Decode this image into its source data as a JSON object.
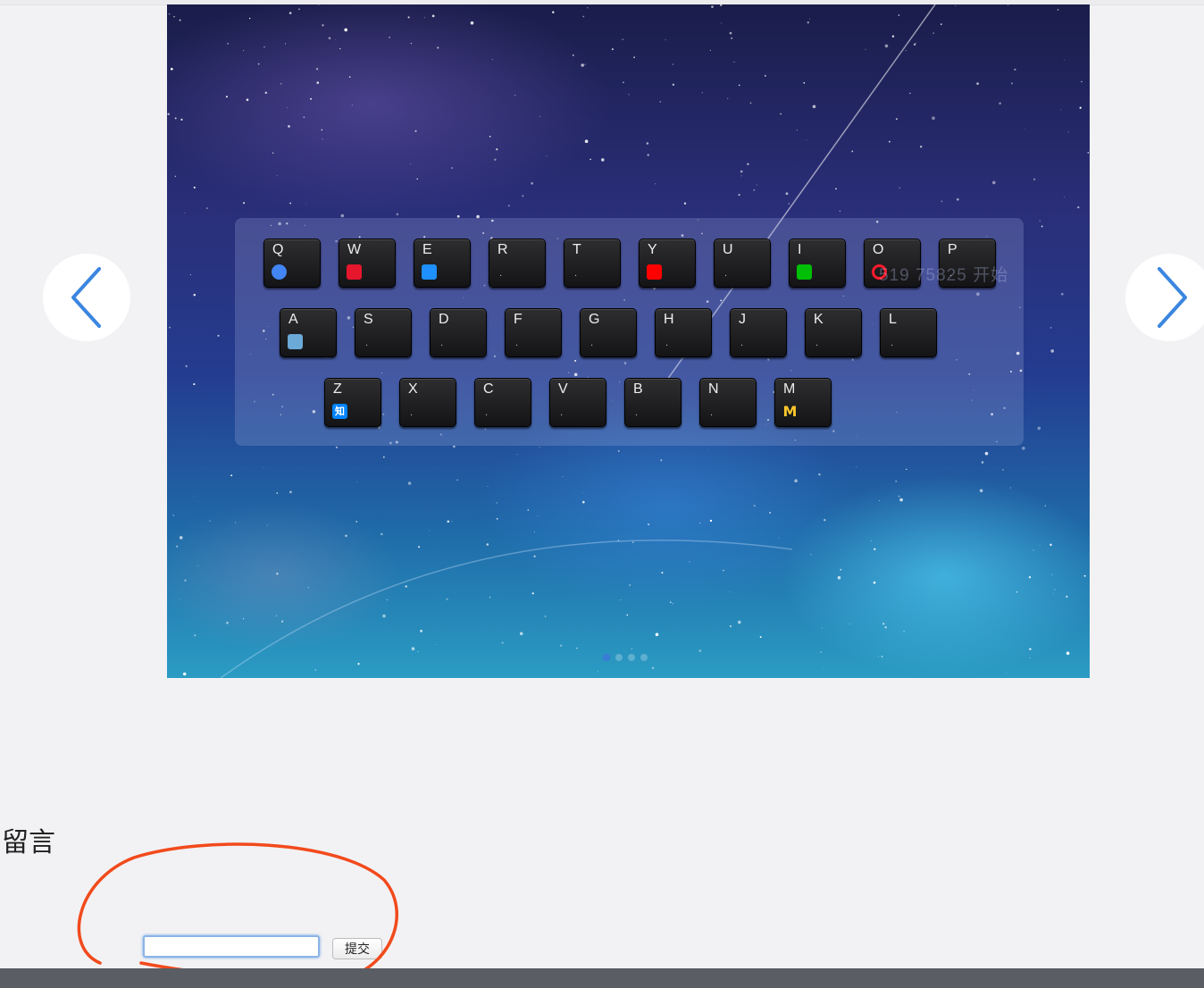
{
  "carousel": {
    "prev_icon": "chevron-left-icon",
    "next_icon": "chevron-right-icon",
    "keyboard": {
      "rows": [
        [
          {
            "letter": "Q",
            "icon": "chrome-icon",
            "color": "#4285f4"
          },
          {
            "letter": "W",
            "icon": "weibo-icon",
            "color": "#e6162d"
          },
          {
            "letter": "E",
            "icon": "ie-icon",
            "color": "#1e90ff"
          },
          {
            "letter": "R",
            "icon": "",
            "color": ""
          },
          {
            "letter": "T",
            "icon": "",
            "color": ""
          },
          {
            "letter": "Y",
            "icon": "youtube-icon",
            "color": "#ff0000"
          },
          {
            "letter": "U",
            "icon": "",
            "color": ""
          },
          {
            "letter": "I",
            "icon": "iqiyi-icon",
            "color": "#00be06"
          },
          {
            "letter": "O",
            "icon": "opera-icon",
            "color": "#ff1b2d"
          },
          {
            "letter": "P",
            "icon": "",
            "color": ""
          }
        ],
        [
          {
            "letter": "A",
            "icon": "avatar-icon",
            "color": "#6aa9d8"
          },
          {
            "letter": "S",
            "icon": "",
            "color": ""
          },
          {
            "letter": "D",
            "icon": "",
            "color": ""
          },
          {
            "letter": "F",
            "icon": "",
            "color": ""
          },
          {
            "letter": "G",
            "icon": "",
            "color": ""
          },
          {
            "letter": "H",
            "icon": "",
            "color": ""
          },
          {
            "letter": "J",
            "icon": "",
            "color": ""
          },
          {
            "letter": "K",
            "icon": "",
            "color": ""
          },
          {
            "letter": "L",
            "icon": "",
            "color": ""
          }
        ],
        [
          {
            "letter": "Z",
            "icon": "zhihu-icon",
            "color": "#0084ff",
            "glyph": "知"
          },
          {
            "letter": "X",
            "icon": "",
            "color": ""
          },
          {
            "letter": "C",
            "icon": "",
            "color": ""
          },
          {
            "letter": "V",
            "icon": "",
            "color": ""
          },
          {
            "letter": "B",
            "icon": "",
            "color": ""
          },
          {
            "letter": "N",
            "icon": "",
            "color": ""
          },
          {
            "letter": "M",
            "icon": "mcdonalds-icon",
            "color": "#ffc72c",
            "glyph": "M"
          }
        ]
      ],
      "ghost_text": "519 75825 开始"
    },
    "slide_count": 4,
    "active_slide": 1
  },
  "comment": {
    "title": "留言",
    "input_value": "",
    "submit_label": "提交"
  }
}
